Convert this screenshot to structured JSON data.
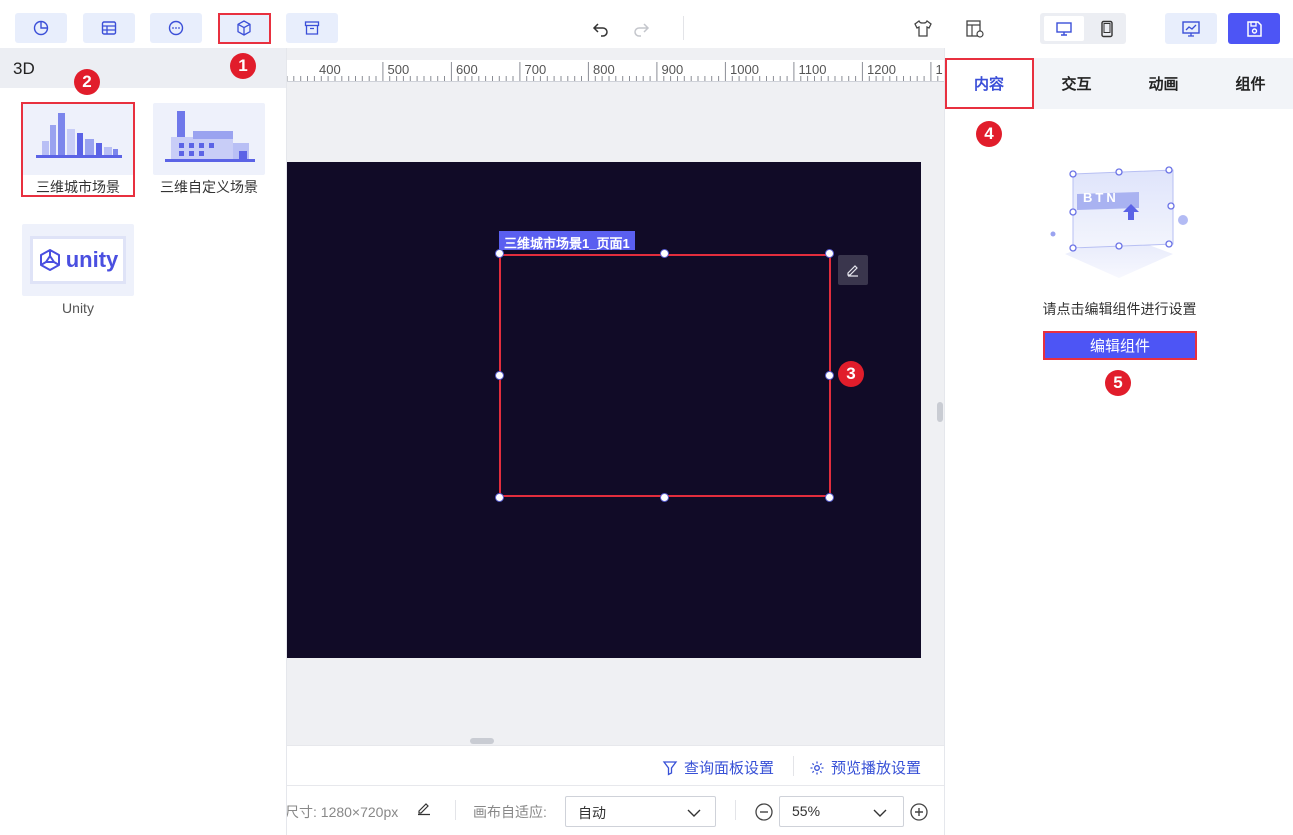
{
  "toolbar": {
    "buttons": [
      {
        "name": "chart-icon"
      },
      {
        "name": "table-icon"
      },
      {
        "name": "more-icon"
      },
      {
        "name": "cube-3d-icon"
      },
      {
        "name": "archive-icon"
      }
    ],
    "undo_icon": "undo-icon",
    "redo_icon": "redo-icon",
    "right_icons": [
      "theme-shirt-icon",
      "layout-settings-icon",
      "desktop-icon",
      "mobile-icon",
      "preview-chart-icon",
      "save-icon"
    ]
  },
  "annotations": [
    "1",
    "2",
    "3",
    "4",
    "5"
  ],
  "left_panel": {
    "title": "3D",
    "items": [
      {
        "label": "三维城市场景"
      },
      {
        "label": "三维自定义场景"
      },
      {
        "label": "Unity"
      }
    ],
    "unity_logo_text": "unity"
  },
  "ruler": {
    "ticks": [
      "400",
      "500",
      "600",
      "700",
      "800",
      "900",
      "1000",
      "1100",
      "1200",
      "1"
    ]
  },
  "canvas": {
    "component_label": "三维城市场景1_页面1"
  },
  "bottom": {
    "query_panel": "查询面板设置",
    "preview_settings": "预览播放设置",
    "size_text": "尺寸: 1280×720px",
    "adapt_label": "画布自适应:",
    "adapt_value": "自动",
    "zoom_value": "55%"
  },
  "right_panel": {
    "tabs": [
      "内容",
      "交互",
      "动画",
      "组件"
    ],
    "hint": "请点击编辑组件进行设置",
    "edit_button": "编辑组件",
    "illustration_text": "BTN"
  },
  "colors": {
    "accent": "#4d55f5",
    "highlight_red": "#e8303f",
    "stage_bg": "#110b27"
  }
}
